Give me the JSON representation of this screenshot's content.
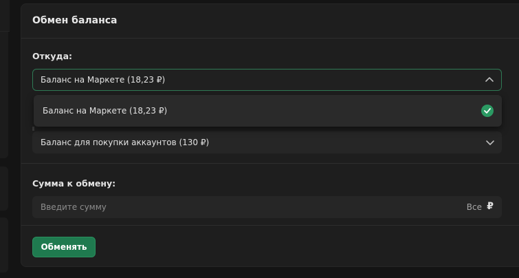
{
  "modal": {
    "title": "Обмен баланса"
  },
  "from": {
    "label": "Откуда:",
    "selected": "Баланс на Маркете (18,23 ₽)",
    "options": [
      {
        "label": "Баланс на Маркете (18,23 ₽)",
        "selected": true
      }
    ]
  },
  "to": {
    "selected": "Баланс для покупки аккаунтов (130 ₽)"
  },
  "amount": {
    "label": "Сумма к обмену:",
    "placeholder": "Введите сумму",
    "all_label": "Все",
    "currency": "₽"
  },
  "actions": {
    "submit_label": "Обменять"
  },
  "colors": {
    "accent": "#1f7a4f",
    "focus_border": "#2f7a55",
    "check": "#2b9a63"
  }
}
